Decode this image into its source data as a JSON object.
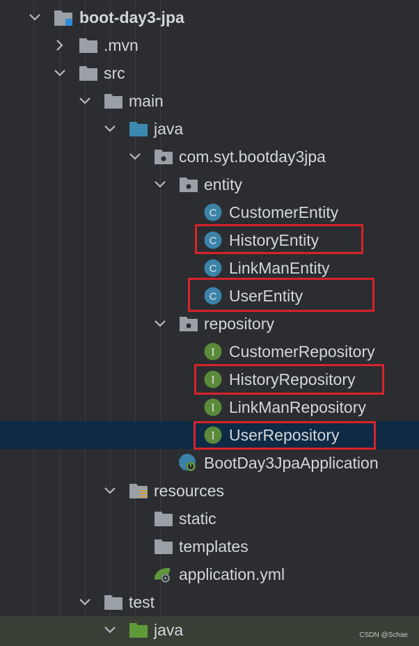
{
  "project_tree": {
    "root": "boot-day3-jpa",
    "mvn": ".mvn",
    "src": "src",
    "main": "main",
    "java": "java",
    "package": "com.syt.bootday3jpa",
    "entity": "entity",
    "entity_items": [
      "CustomerEntity",
      "HistoryEntity",
      "LinkManEntity",
      "UserEntity"
    ],
    "repository": "repository",
    "repository_items": [
      "CustomerRepository",
      "HistoryRepository",
      "LinkManRepository",
      "UserRepository"
    ],
    "application_class": "BootDay3JpaApplication",
    "resources": "resources",
    "static": "static",
    "templates": "templates",
    "application_yml": "application.yml",
    "test": "test",
    "test_java": "java"
  },
  "class_icon_letter": "C",
  "interface_icon_letter": "I",
  "watermark": "CSDN @Schae",
  "colors": {
    "background": "#2b2d30",
    "selected_row": "#0f2a44",
    "test_row": "#3a3f36",
    "class_icon": "#3b82a8",
    "interface_icon": "#5a8a3a",
    "folder": "#9aa0a6",
    "source_folder": "#3c89b0",
    "test_folder": "#5e9a38",
    "highlight": "#d8232a"
  }
}
